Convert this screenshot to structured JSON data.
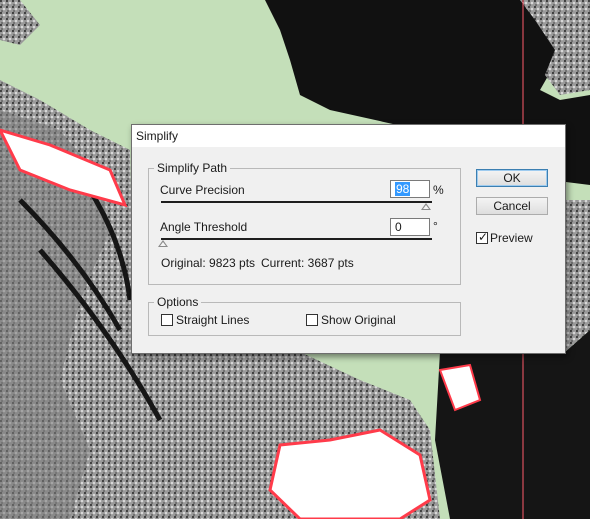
{
  "dialog": {
    "title": "Simplify",
    "simplify_path": {
      "legend": "Simplify Path",
      "curve_precision": {
        "label": "Curve Precision",
        "value": "98",
        "unit": "%",
        "slider_fraction": 0.98
      },
      "angle_threshold": {
        "label": "Angle Threshold",
        "value": "0",
        "unit": "°",
        "slider_fraction": 0.0
      },
      "original": "Original: 9823 pts",
      "current": "Current: 3687 pts"
    },
    "options": {
      "legend": "Options",
      "straight_lines": {
        "label": "Straight Lines",
        "checked": false
      },
      "show_original": {
        "label": "Show Original",
        "checked": false
      }
    },
    "buttons": {
      "ok": "OK",
      "cancel": "Cancel"
    },
    "preview": {
      "label": "Preview",
      "checked": true
    }
  },
  "colors": {
    "background": "#c4dfb9",
    "artwork_dark": "#111111",
    "artwork_gray": "#8c8c8c",
    "highlight": "#ff3b4a",
    "guide": "#ff5a6a"
  }
}
